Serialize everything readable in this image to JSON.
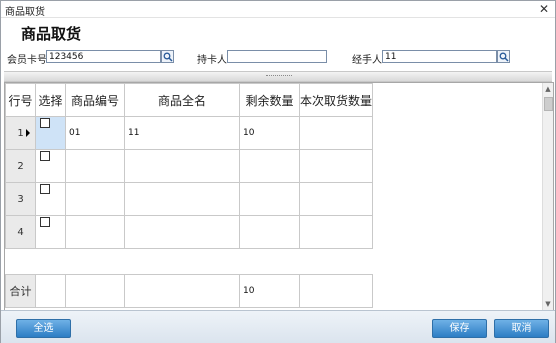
{
  "window": {
    "title": "商品取货"
  },
  "header": {
    "title": "商品取货"
  },
  "fields": {
    "member_card": {
      "label": "会员卡号",
      "value": "123456"
    },
    "card_holder": {
      "label": "持卡人",
      "value": ""
    },
    "handler": {
      "label": "经手人",
      "value": "11"
    }
  },
  "grid": {
    "columns": [
      "行号",
      "选择",
      "商品编号",
      "商品全名",
      "剩余数量",
      "本次取货数量"
    ],
    "rows": [
      {
        "row_no": "1",
        "code": "01",
        "name": "11",
        "remaining": "10",
        "pickup": ""
      },
      {
        "row_no": "2",
        "code": "",
        "name": "",
        "remaining": "",
        "pickup": ""
      },
      {
        "row_no": "3",
        "code": "",
        "name": "",
        "remaining": "",
        "pickup": ""
      },
      {
        "row_no": "4",
        "code": "",
        "name": "",
        "remaining": "",
        "pickup": ""
      }
    ],
    "total": {
      "label": "合计",
      "remaining": "10",
      "pickup": ""
    }
  },
  "buttons": {
    "select_all": "全选",
    "save": "保存",
    "cancel": "取消"
  },
  "colors": {
    "button_blue": "#2d7dc4",
    "selected_cell": "#cfe3f7",
    "row_header_gray": "#eaeaea"
  },
  "icons": {
    "search": "search-icon",
    "close": "close-icon"
  }
}
